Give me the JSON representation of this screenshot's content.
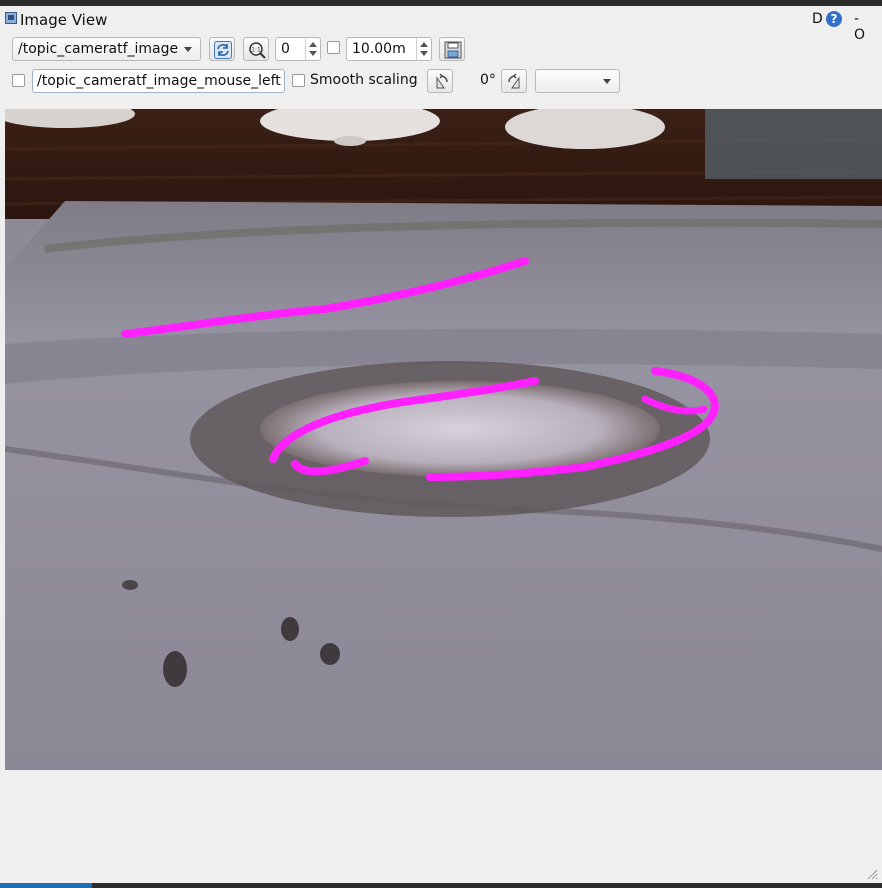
{
  "window": {
    "title": "Image View"
  },
  "title_controls": {
    "help_letter": "D",
    "help_icon": "?",
    "window_controls": "- O"
  },
  "toolbar": {
    "topic_select": {
      "value": "/topic_cameratf_image"
    },
    "refresh_icon": "refresh-icon",
    "zoom_icon": "zoom-reset-icon",
    "rotation_spin": {
      "value": "0"
    },
    "rate_checkbox": {
      "checked": false
    },
    "max_range_spin": {
      "value": "10.00m"
    },
    "save_icon": "save-image-icon"
  },
  "row2": {
    "mouse_checkbox": {
      "checked": false
    },
    "mouse_topic_field": {
      "value": "/topic_cameratf_image_mouse_left"
    },
    "smooth_checkbox": {
      "checked": false,
      "label": "Smooth scaling"
    },
    "rotate_left_icon": "rotate-ccw-icon",
    "rotation_label": "0°",
    "rotate_right_icon": "rotate-cw-icon",
    "color_scheme_select": {
      "value": ""
    }
  },
  "image": {
    "overlay_color": "#ff1fff"
  }
}
